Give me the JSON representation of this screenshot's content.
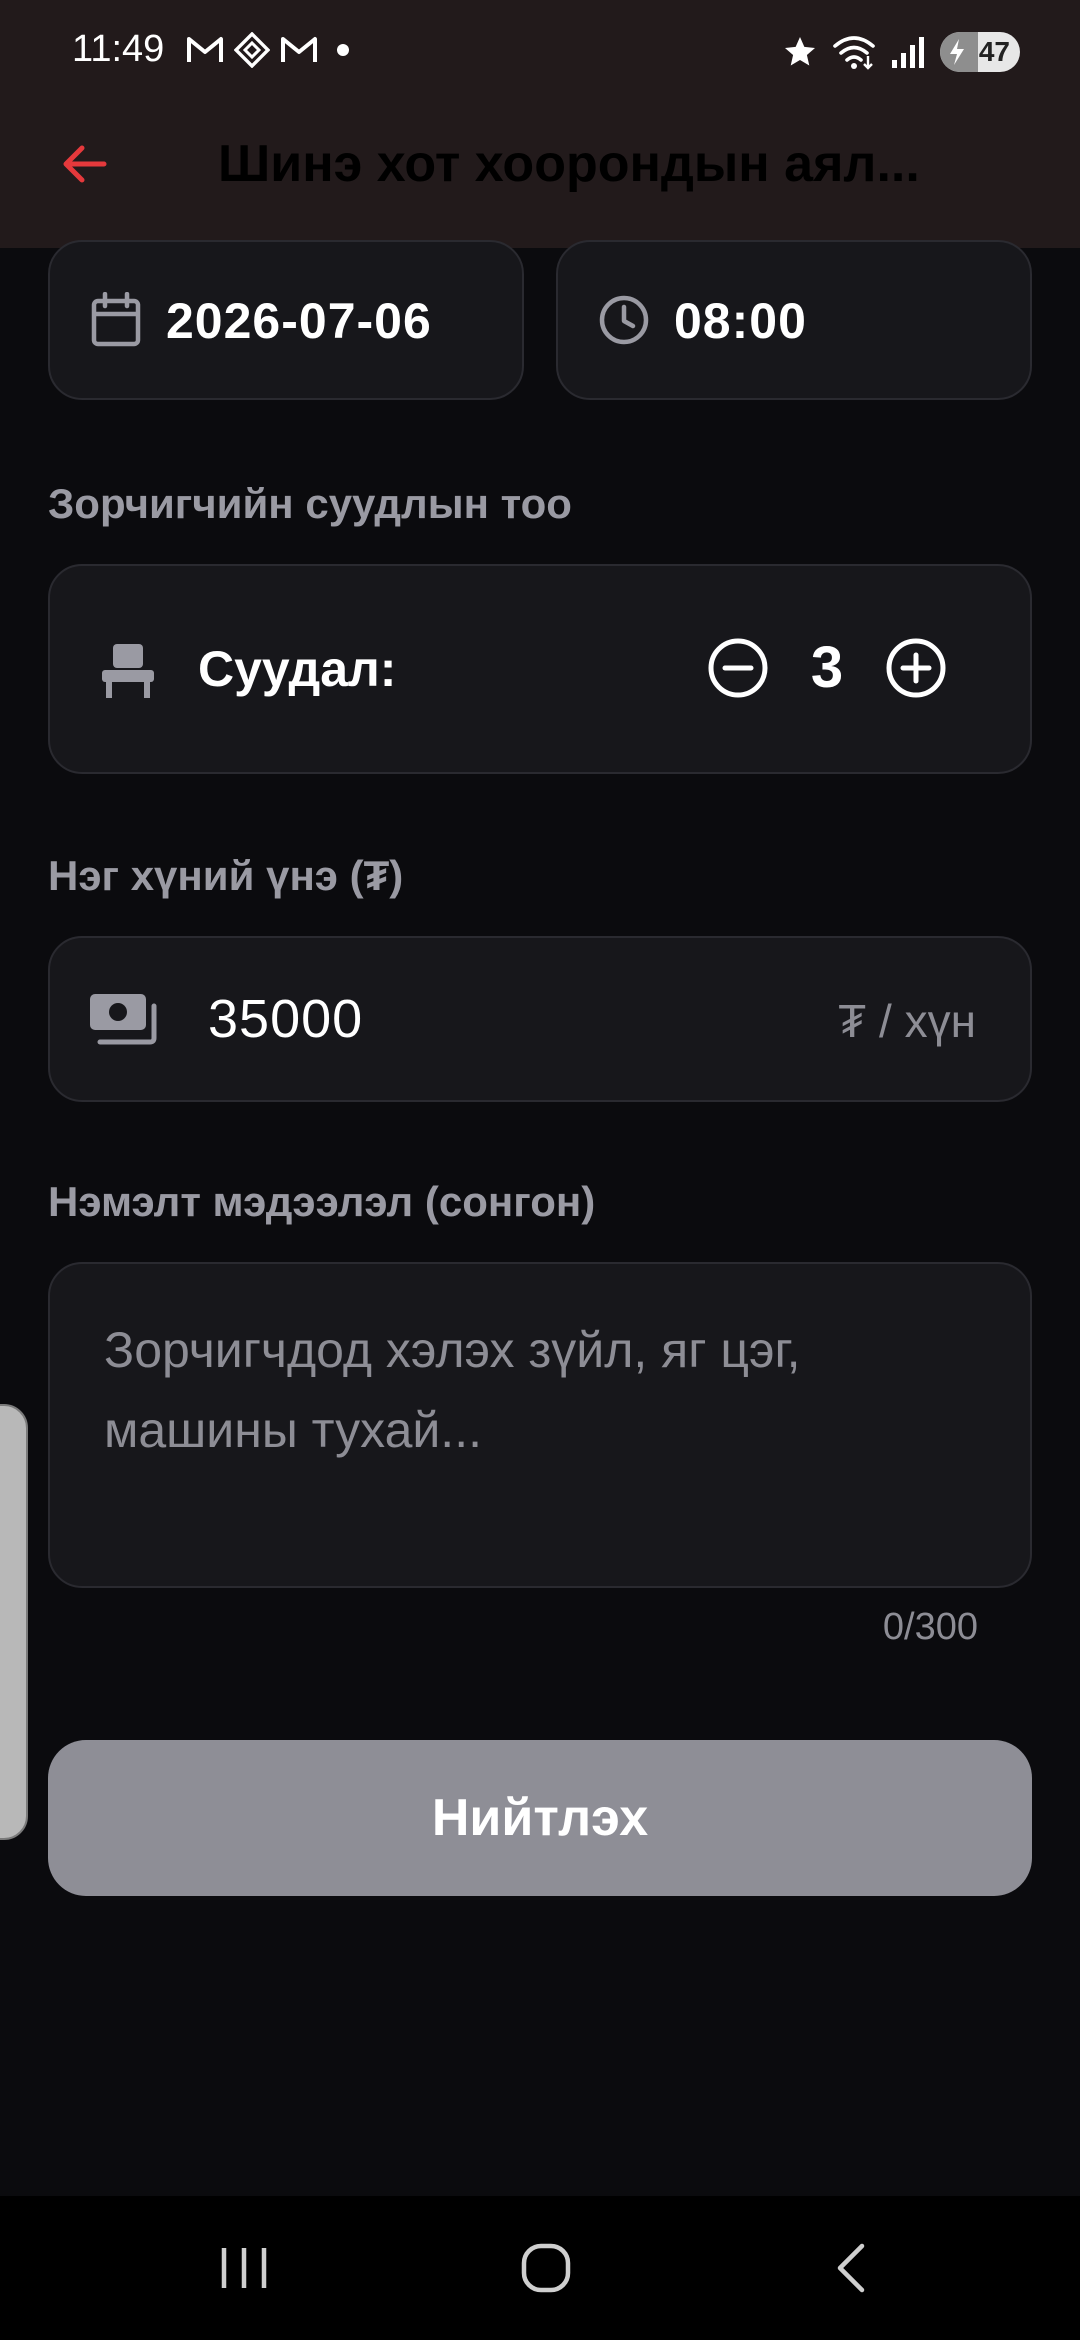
{
  "status_bar": {
    "time": "11:49",
    "battery": "47",
    "battery_level": 47,
    "icons": [
      "gmail-icon",
      "binance-icon",
      "gmail-icon",
      "notification-dot-icon",
      "star-icon",
      "wifi-icon",
      "signal-icon",
      "battery-icon"
    ]
  },
  "app_bar": {
    "title": "Шинэ хот хоорондын аял...",
    "back_icon": "arrow-left-icon"
  },
  "form": {
    "date": "2026-07-06",
    "time": "08:00",
    "seats": {
      "section_label": "Зорчигчийн суудлын тоо",
      "label": "Суудал:",
      "count": "3"
    },
    "price": {
      "section_label": "Нэг хүний үнэ (₮)",
      "value": "35000",
      "suffix": "₮ / хүн"
    },
    "note": {
      "section_label": "Нэмэлт мэдээлэл (сонгон)",
      "placeholder": "Зорчигчдод хэлэх зүйл, яг цэг, машины тухай...",
      "counter": "0/300"
    },
    "submit_label": "Нийтлэх"
  },
  "colors": {
    "background": "#0b0b0e",
    "card": "#17171b",
    "header": "#221a1b",
    "accent_red": "#e5393c",
    "muted": "#9a9aa3",
    "button_disabled": "#8e8e96"
  }
}
